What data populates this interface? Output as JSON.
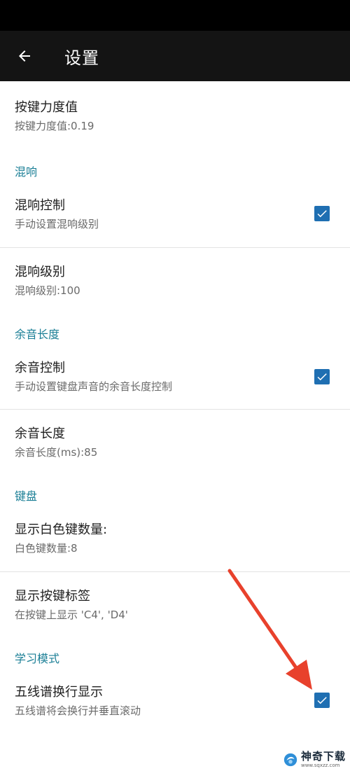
{
  "app_bar": {
    "title": "设置"
  },
  "settings": {
    "key_force": {
      "title": "按键力度值",
      "summary": "按键力度值:0.19"
    },
    "reverb_category": "混响",
    "reverb_control": {
      "title": "混响控制",
      "summary": "手动设置混响级别",
      "checked": true
    },
    "reverb_level": {
      "title": "混响级别",
      "summary": "混响级别:100"
    },
    "sustain_category": "余音长度",
    "sustain_control": {
      "title": "余音控制",
      "summary": "手动设置键盘声音的余音长度控制",
      "checked": true
    },
    "sustain_length": {
      "title": "余音长度",
      "summary": "余音长度(ms):85"
    },
    "keyboard_category": "键盘",
    "white_key_count": {
      "title": "显示白色键数量:",
      "summary": "白色键数量:8"
    },
    "key_labels": {
      "title": "显示按键标签",
      "summary": "在按键上显示 'C4', 'D4'"
    },
    "learning_category": "学习模式",
    "staff_wrap": {
      "title": "五线谱换行显示",
      "summary": "五线谱将会换行并垂直滚动",
      "checked": true
    }
  },
  "watermark": {
    "main": "神奇下载",
    "sub": "www.sqxzz.com"
  },
  "colors": {
    "accent": "#1f6fb2",
    "category": "#1b7f96",
    "annotation_arrow": "#e8412c"
  }
}
